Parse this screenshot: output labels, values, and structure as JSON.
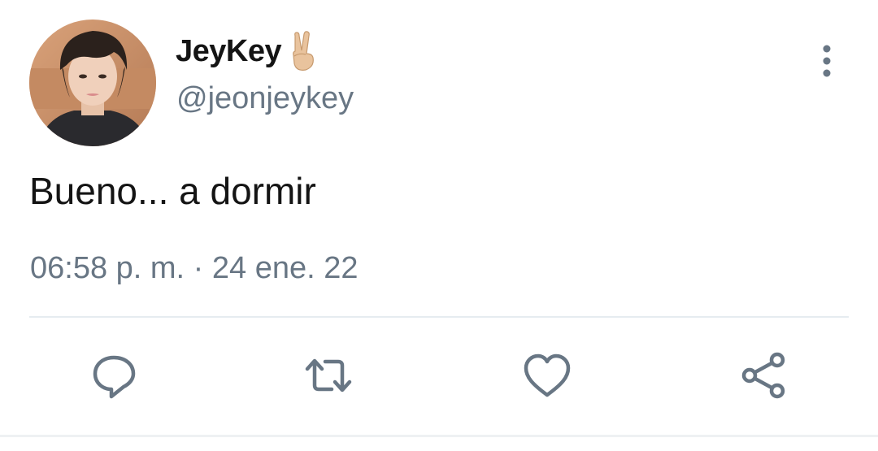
{
  "tweet": {
    "display_name": "JeyKey",
    "handle": "@jeonjeykey",
    "text": "Bueno... a dormir",
    "timestamp": "06:58 p. m. · 24 ene. 22"
  },
  "icons": {
    "name_emoji": "victory-hand-icon",
    "more": "more-vertical-icon",
    "actions": [
      "reply-icon",
      "retweet-icon",
      "like-icon",
      "share-icon"
    ]
  },
  "colors": {
    "text": "#141414",
    "secondary": "#687684",
    "divider": "#e6ecf0"
  }
}
